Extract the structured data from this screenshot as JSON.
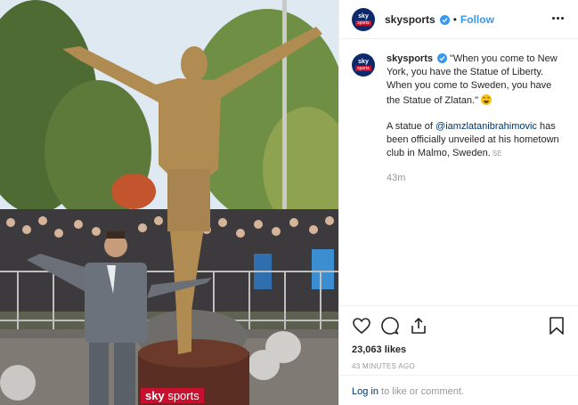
{
  "post": {
    "username": "skysports",
    "follow_label": "Follow",
    "separator": "•",
    "avatar": {
      "line1": "sky",
      "line2": "sports"
    },
    "watermark": {
      "part1": "sky",
      "part2": "sports"
    }
  },
  "caption": {
    "username": "skysports",
    "quote": "\"When you come to New York, you have the Statue of Liberty. When you come to Sweden, you have the Statue of Zlatan.\"",
    "para2_before": "A statue of ",
    "mention": "@iamzlatanibrahimovic",
    "para2_after": " has been officially unveiled at his hometown club in Malmo, Sweden.",
    "more": "SE",
    "time_ago": "43m"
  },
  "stats": {
    "likes": "23,063 likes",
    "posted": "43 MINUTES AGO"
  },
  "login": {
    "link": "Log in",
    "rest": " to like or comment."
  },
  "colors": {
    "accent": "#3897f0",
    "brand_navy": "#0c2a6b",
    "brand_red": "#c8102e"
  },
  "icons": [
    "verified-badge-icon",
    "more-options-icon",
    "heart-icon",
    "comment-icon",
    "share-icon",
    "bookmark-icon",
    "laughing-emoji-icon"
  ]
}
